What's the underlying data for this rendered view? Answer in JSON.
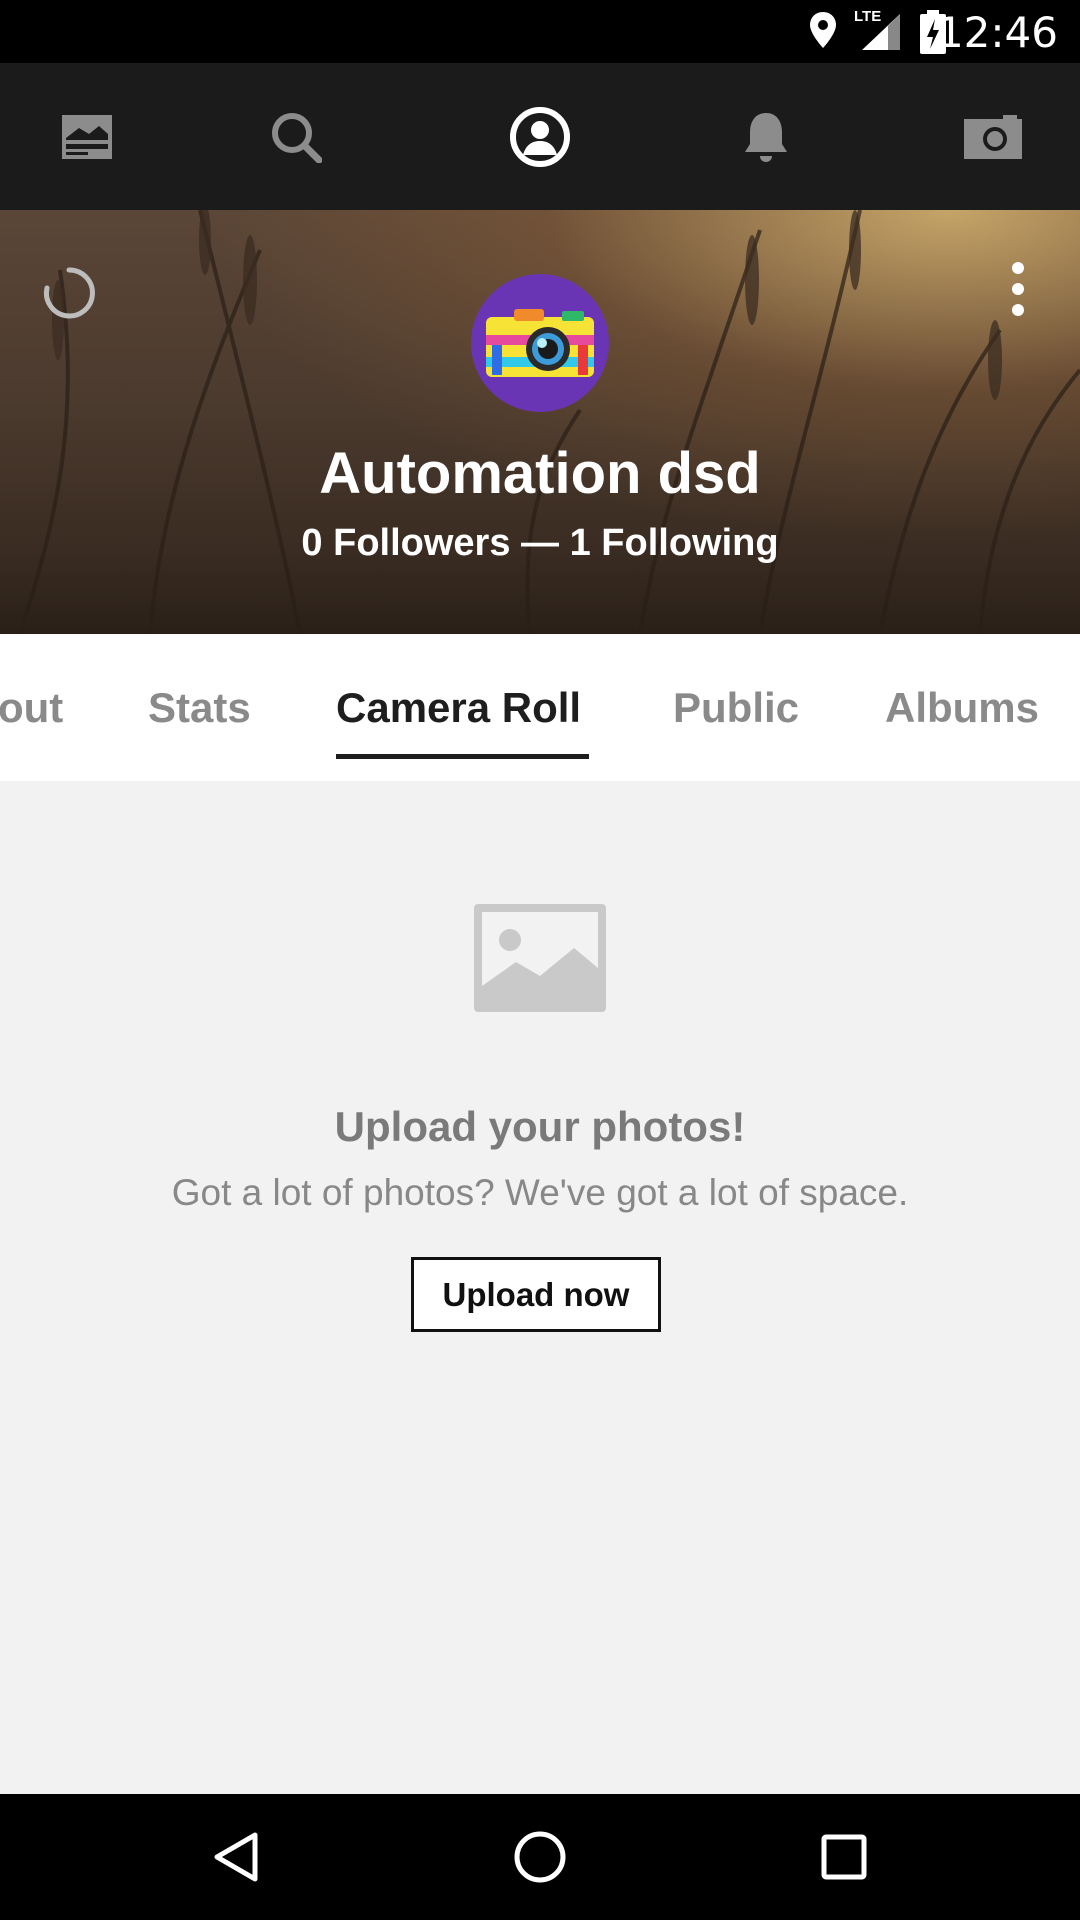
{
  "status_bar": {
    "time": "12:46",
    "network_label": "LTE",
    "icons": [
      "location-icon",
      "signal-icon",
      "battery-charging-icon"
    ]
  },
  "app_nav": {
    "items": [
      {
        "name": "feed",
        "icon": "feed-icon"
      },
      {
        "name": "search",
        "icon": "search-icon"
      },
      {
        "name": "profile",
        "icon": "profile-icon",
        "active": true
      },
      {
        "name": "notifications",
        "icon": "bell-icon"
      },
      {
        "name": "camera",
        "icon": "camera-icon"
      }
    ]
  },
  "profile": {
    "name": "Automation dsd",
    "followers_following": "0 Followers — 1 Following",
    "avatar_icon": "camera-avatar-icon"
  },
  "tabs": {
    "items": [
      "out",
      "Stats",
      "Camera Roll",
      "Public",
      "Albums"
    ],
    "active": "Camera Roll"
  },
  "empty_state": {
    "icon": "image-placeholder-icon",
    "title": "Upload your photos!",
    "subtitle": "Got a lot of photos? We've got a lot of space.",
    "button_label": "Upload now"
  },
  "colors": {
    "app_nav_bg": "#1b1b1b",
    "avatar_bg": "#6a35b5",
    "content_bg": "#f2f2f2"
  },
  "system_nav": {
    "icons": [
      "back-icon",
      "home-icon",
      "recents-icon"
    ]
  }
}
